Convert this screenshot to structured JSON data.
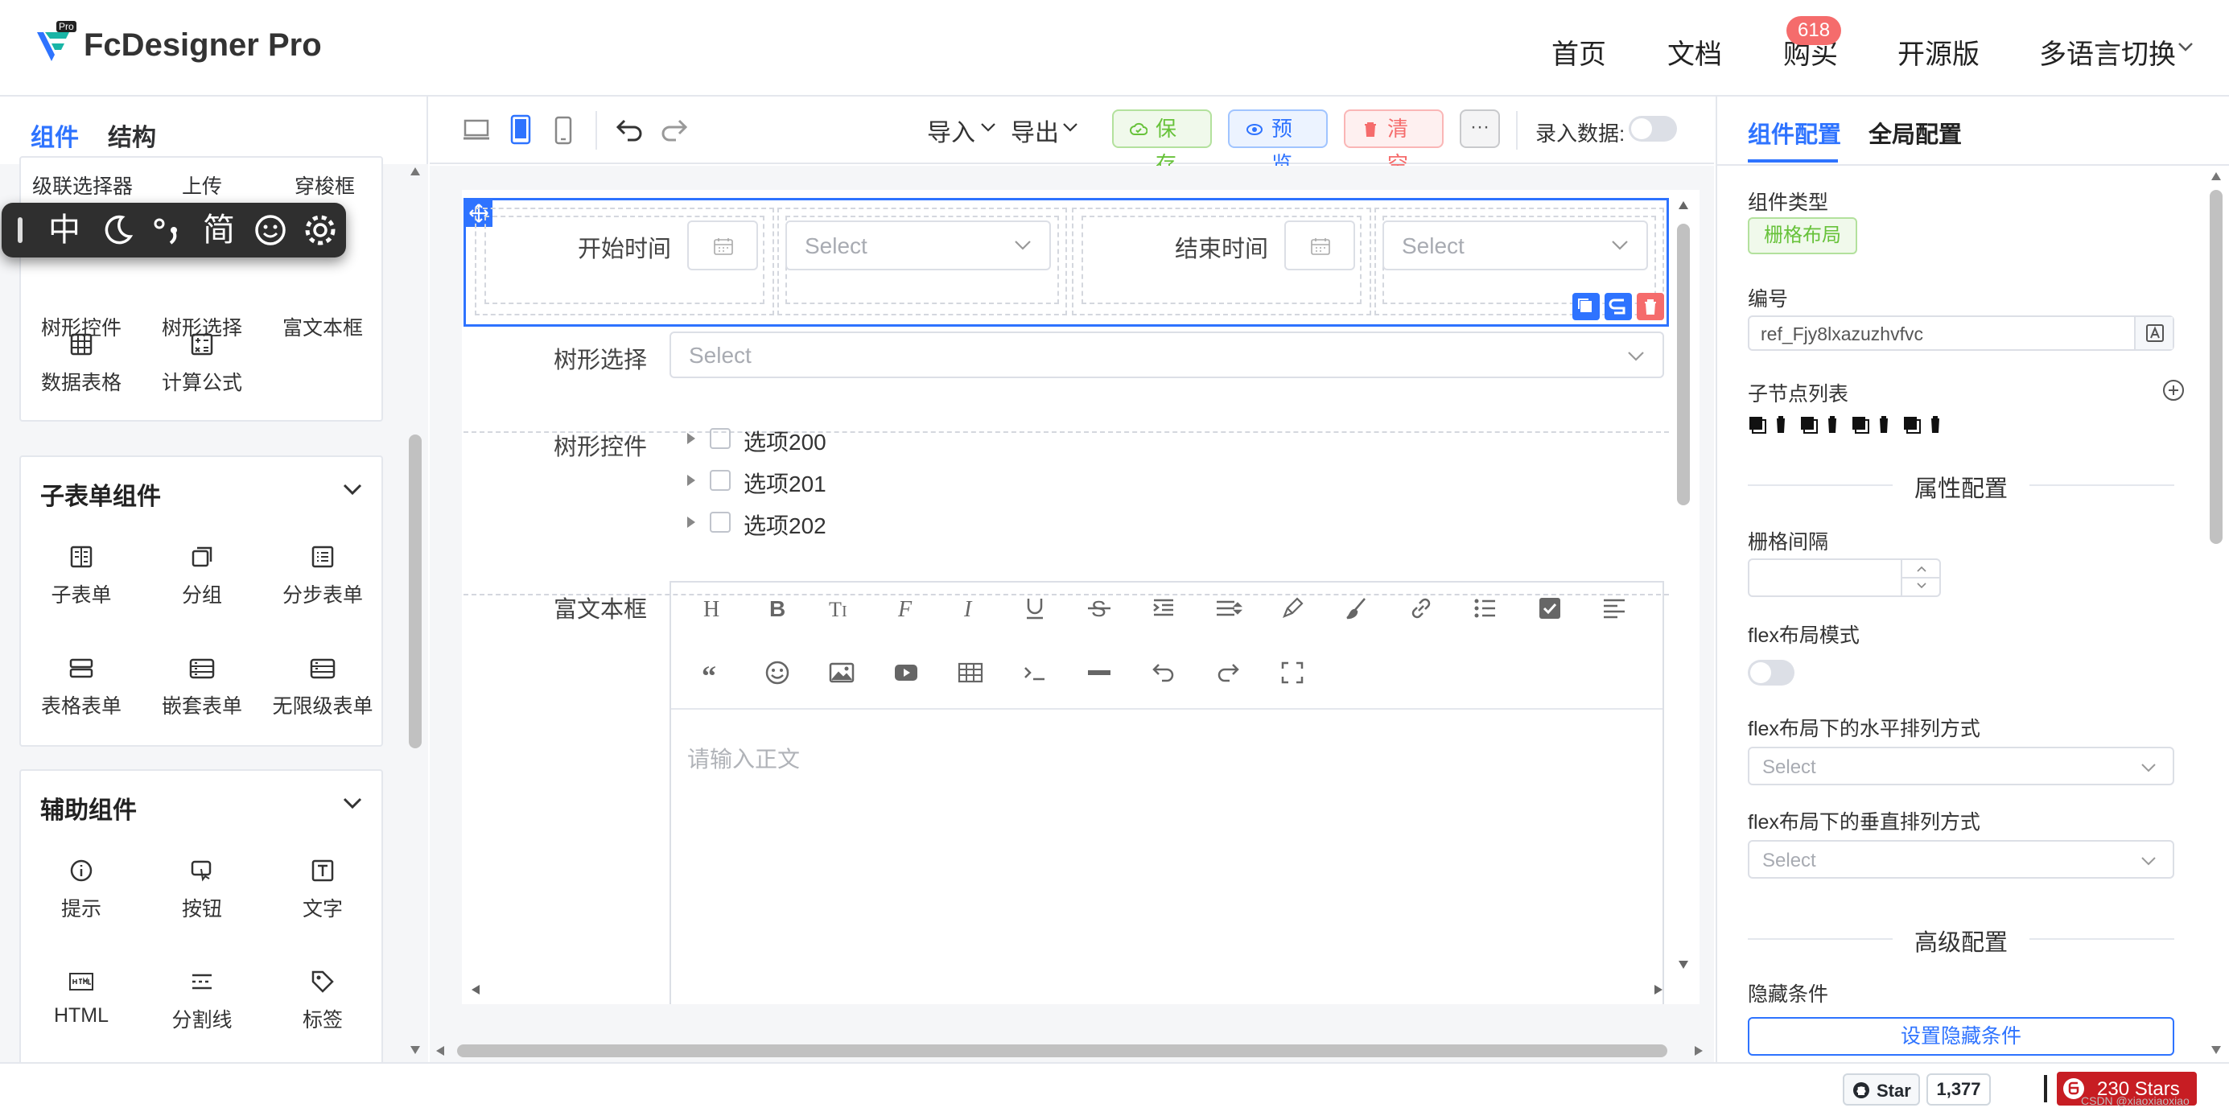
{
  "header": {
    "app_name": "FcDesigner Pro",
    "logo_tag": "Pro",
    "nav": [
      "首页",
      "文档",
      "购买",
      "开源版",
      "多语言切换"
    ],
    "badge": "618"
  },
  "left_panel": {
    "tabs": [
      "组件",
      "结构"
    ],
    "partial_row": [
      "级联选择器",
      "上传",
      "穿梭框"
    ],
    "row2": [
      "树形控件",
      "树形选择",
      "富文本框"
    ],
    "row3": [
      "数据表格",
      "计算公式"
    ],
    "subform": {
      "title": "子表单组件",
      "items": [
        "子表单",
        "分组",
        "分步表单",
        "表格表单",
        "嵌套表单",
        "无限级表单"
      ]
    },
    "aux": {
      "title": "辅助组件",
      "items": [
        "提示",
        "按钮",
        "文字",
        "HTML",
        "分割线",
        "标签"
      ]
    }
  },
  "float_toolbar": {
    "items": [
      "中",
      "简"
    ]
  },
  "toolbar": {
    "import": "导入",
    "export": "导出",
    "save": "保存",
    "preview": "预览",
    "clear": "清空",
    "more": "···",
    "input_data": "录入数据:"
  },
  "canvas": {
    "start_time": "开始时间",
    "end_time": "结束时间",
    "select_placeholder": "Select",
    "tree_select_label": "树形选择",
    "tree_label": "树形控件",
    "tree_items": [
      "选项200",
      "选项201",
      "选项202"
    ],
    "rich_label": "富文本框",
    "rich_placeholder": "请输入正文"
  },
  "right_panel": {
    "tabs": [
      "组件配置",
      "全局配置"
    ],
    "type_label": "组件类型",
    "type_value": "栅格布局",
    "id_label": "编号",
    "id_value": "ref_Fjy8lxazuzhvfvc",
    "children_label": "子节点列表",
    "attr_section": "属性配置",
    "gutter_label": "栅格间隔",
    "flex_label": "flex布局模式",
    "flex_h_label": "flex布局下的水平排列方式",
    "flex_v_label": "flex布局下的垂直排列方式",
    "select_placeholder": "Select",
    "advanced_section": "高级配置",
    "hide_label": "隐藏条件",
    "hide_button": "设置隐藏条件"
  },
  "footer": {
    "star_label": "Star",
    "star_count": "1,377",
    "gitee_stars": "230 Stars",
    "watermark": "CSDN @xiaoxiaoxiao"
  },
  "colors": {
    "accent": "#2e73ff",
    "save": "#67c23a",
    "clear": "#f56c6c",
    "selected_border": "#2e73ff"
  }
}
